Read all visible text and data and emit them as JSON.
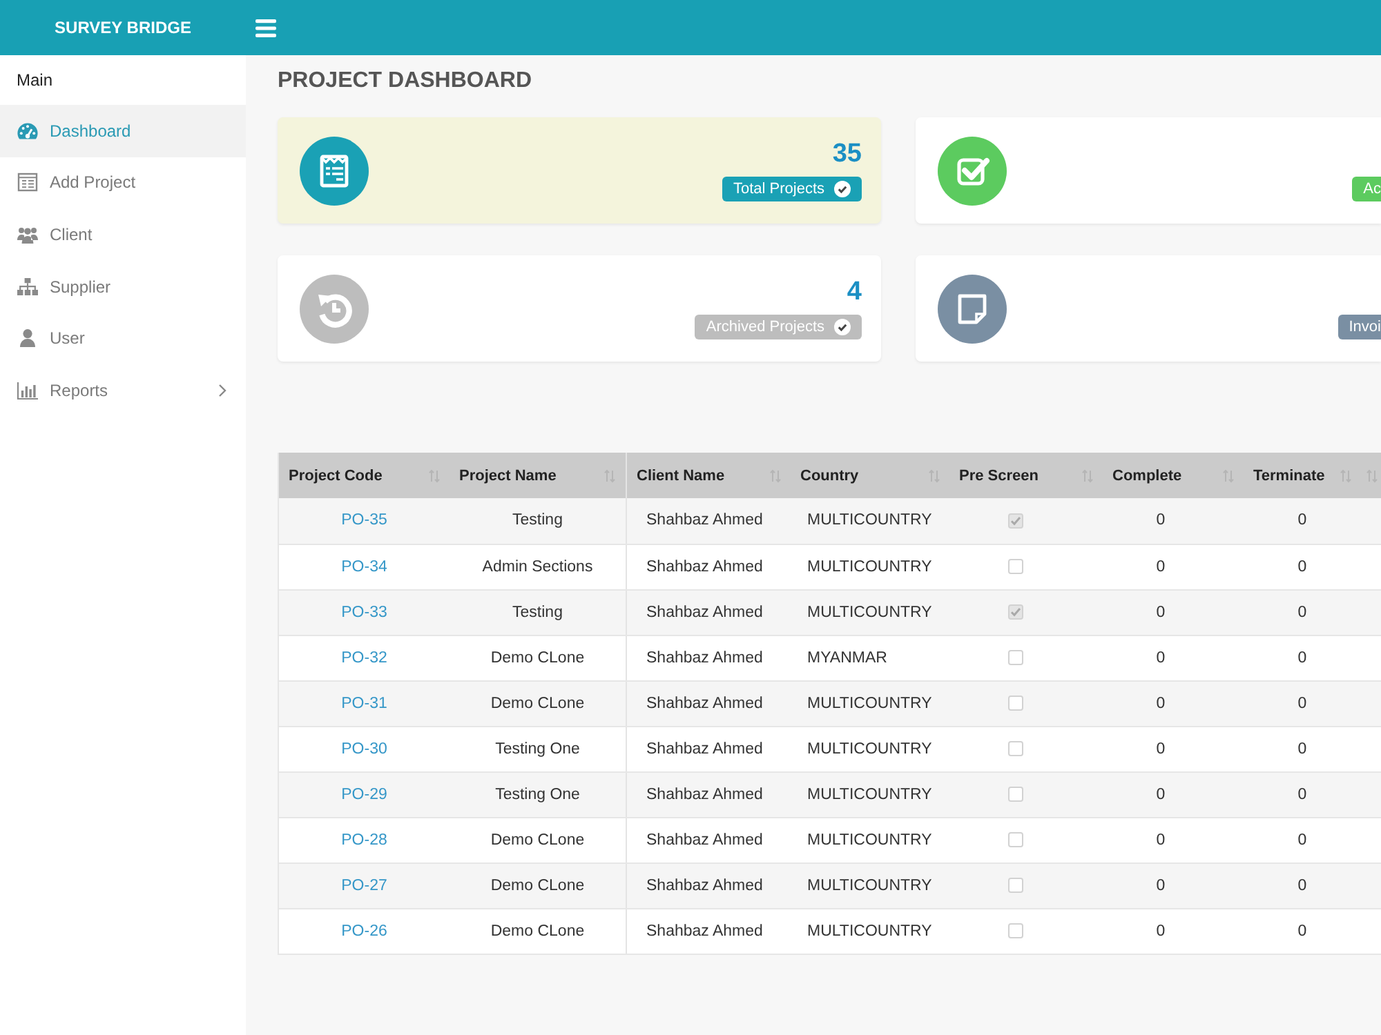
{
  "header": {
    "brand": "SURVEY BRIDGE"
  },
  "sidebar": {
    "section": "Main",
    "items": [
      {
        "label": "Dashboard",
        "kind": "link",
        "selected": true
      },
      {
        "label": "Add Project",
        "kind": "link",
        "selected": false
      },
      {
        "label": "Client",
        "kind": "link",
        "selected": false
      },
      {
        "label": "Supplier",
        "kind": "link",
        "selected": false
      },
      {
        "label": "User",
        "kind": "link",
        "selected": false
      },
      {
        "label": "Reports",
        "kind": "submenu",
        "selected": false
      }
    ]
  },
  "page": {
    "title": "PROJECT DASHBOARD"
  },
  "cards": [
    {
      "value": "35",
      "label": "Total Projects",
      "color": "#1aa1b5",
      "highlighted": true,
      "badge_check": true
    },
    {
      "label": "Ac",
      "color": "#5ccb5f",
      "highlighted": false,
      "badge_check": false
    },
    {
      "value": "4",
      "label": "Archived Projects",
      "color": "#bdbdbd",
      "highlighted": false,
      "badge_check": true
    },
    {
      "label": "Invoi",
      "color": "#7a8fa3",
      "highlighted": false,
      "badge_check": false
    }
  ],
  "table": {
    "columns": [
      "Project Code",
      "Project Name",
      "Client Name",
      "Country",
      "Pre Screen",
      "Complete",
      "Terminate"
    ],
    "rows": [
      {
        "code": "PO-35",
        "name": "Testing",
        "client": "Shahbaz Ahmed",
        "country": "MULTICOUNTRY",
        "pre_screen": true,
        "complete": "0",
        "terminate": "0"
      },
      {
        "code": "PO-34",
        "name": "Admin Sections",
        "client": "Shahbaz Ahmed",
        "country": "MULTICOUNTRY",
        "pre_screen": false,
        "complete": "0",
        "terminate": "0"
      },
      {
        "code": "PO-33",
        "name": "Testing",
        "client": "Shahbaz Ahmed",
        "country": "MULTICOUNTRY",
        "pre_screen": true,
        "complete": "0",
        "terminate": "0"
      },
      {
        "code": "PO-32",
        "name": "Demo CLone",
        "client": "Shahbaz Ahmed",
        "country": "MYANMAR",
        "pre_screen": false,
        "complete": "0",
        "terminate": "0"
      },
      {
        "code": "PO-31",
        "name": "Demo CLone",
        "client": "Shahbaz Ahmed",
        "country": "MULTICOUNTRY",
        "pre_screen": false,
        "complete": "0",
        "terminate": "0"
      },
      {
        "code": "PO-30",
        "name": "Testing One",
        "client": "Shahbaz Ahmed",
        "country": "MULTICOUNTRY",
        "pre_screen": false,
        "complete": "0",
        "terminate": "0"
      },
      {
        "code": "PO-29",
        "name": "Testing One",
        "client": "Shahbaz Ahmed",
        "country": "MULTICOUNTRY",
        "pre_screen": false,
        "complete": "0",
        "terminate": "0"
      },
      {
        "code": "PO-28",
        "name": "Demo CLone",
        "client": "Shahbaz Ahmed",
        "country": "MULTICOUNTRY",
        "pre_screen": false,
        "complete": "0",
        "terminate": "0"
      },
      {
        "code": "PO-27",
        "name": "Demo CLone",
        "client": "Shahbaz Ahmed",
        "country": "MULTICOUNTRY",
        "pre_screen": false,
        "complete": "0",
        "terminate": "0"
      },
      {
        "code": "PO-26",
        "name": "Demo CLone",
        "client": "Shahbaz Ahmed",
        "country": "MULTICOUNTRY",
        "pre_screen": false,
        "complete": "0",
        "terminate": "0"
      }
    ]
  }
}
